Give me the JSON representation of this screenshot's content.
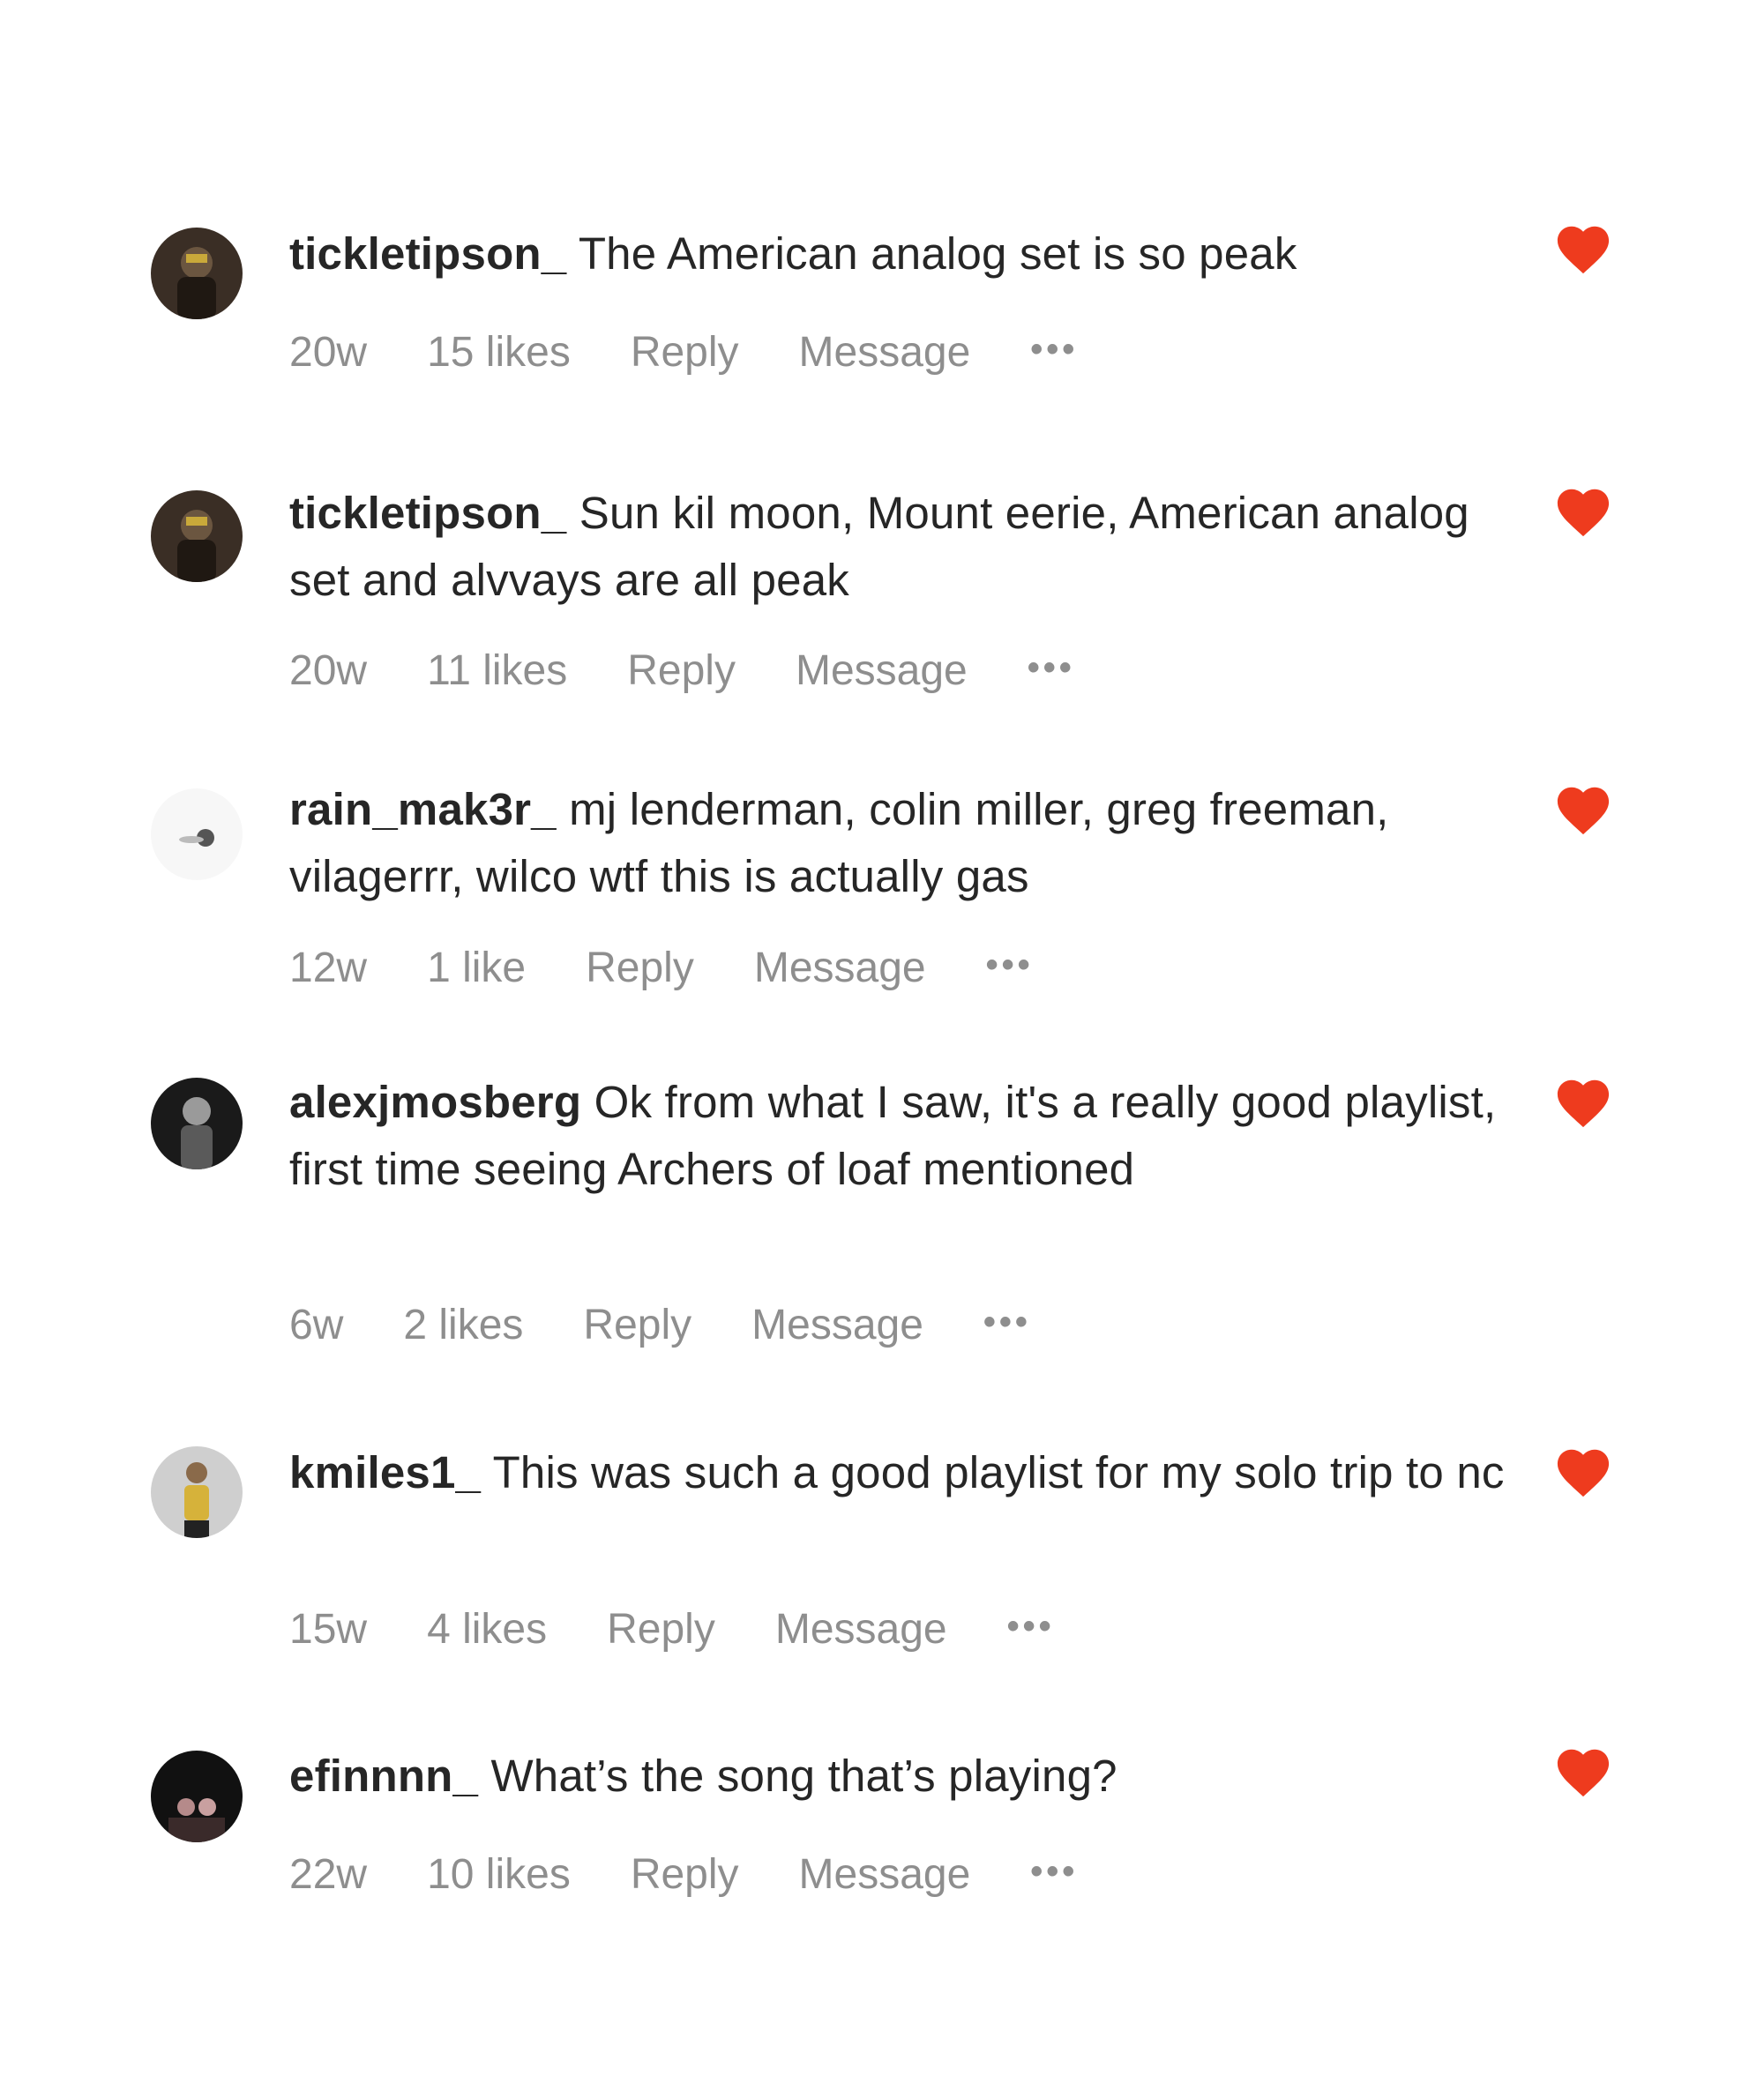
{
  "colors": {
    "like_heart": "#EE3B1E",
    "username": "#262626",
    "meta": "#8E8E8E"
  },
  "comments": [
    {
      "username": "tickletipson_",
      "text": "The American analog set is so peak",
      "time": "20w",
      "likes": "15 likes",
      "reply": "Reply",
      "message": "Message",
      "more": "•••",
      "liked_icon": "heart-filled-icon"
    },
    {
      "username": "tickletipson_",
      "text": "Sun kil moon, Mount eerie, American analog set and alvvays are all peak",
      "time": "20w",
      "likes": "11 likes",
      "reply": "Reply",
      "message": "Message",
      "more": "•••",
      "liked_icon": "heart-filled-icon"
    },
    {
      "username": "rain_mak3r_",
      "text": "mj lenderman, colin miller, greg freeman, vilagerrr, wilco wtf this is actually gas",
      "time": "12w",
      "likes": "1 like",
      "reply": "Reply",
      "message": "Message",
      "more": "•••",
      "liked_icon": "heart-filled-icon"
    },
    {
      "username": "alexjmosberg",
      "text": "Ok from what I saw, it's a really good playlist, first time seeing Archers of loaf mentioned",
      "time": "6w",
      "likes": "2 likes",
      "reply": "Reply",
      "message": "Message",
      "more": "•••",
      "liked_icon": "heart-filled-icon"
    },
    {
      "username": "kmiles1_",
      "text": "This was such a good playlist for my solo trip to nc",
      "time": "15w",
      "likes": "4 likes",
      "reply": "Reply",
      "message": "Message",
      "more": "•••",
      "liked_icon": "heart-filled-icon"
    },
    {
      "username": "efinnnn_",
      "text": "What’s the song that’s playing?",
      "time": "22w",
      "likes": "10 likes",
      "reply": "Reply",
      "message": "Message",
      "more": "•••",
      "liked_icon": "heart-filled-icon"
    }
  ]
}
